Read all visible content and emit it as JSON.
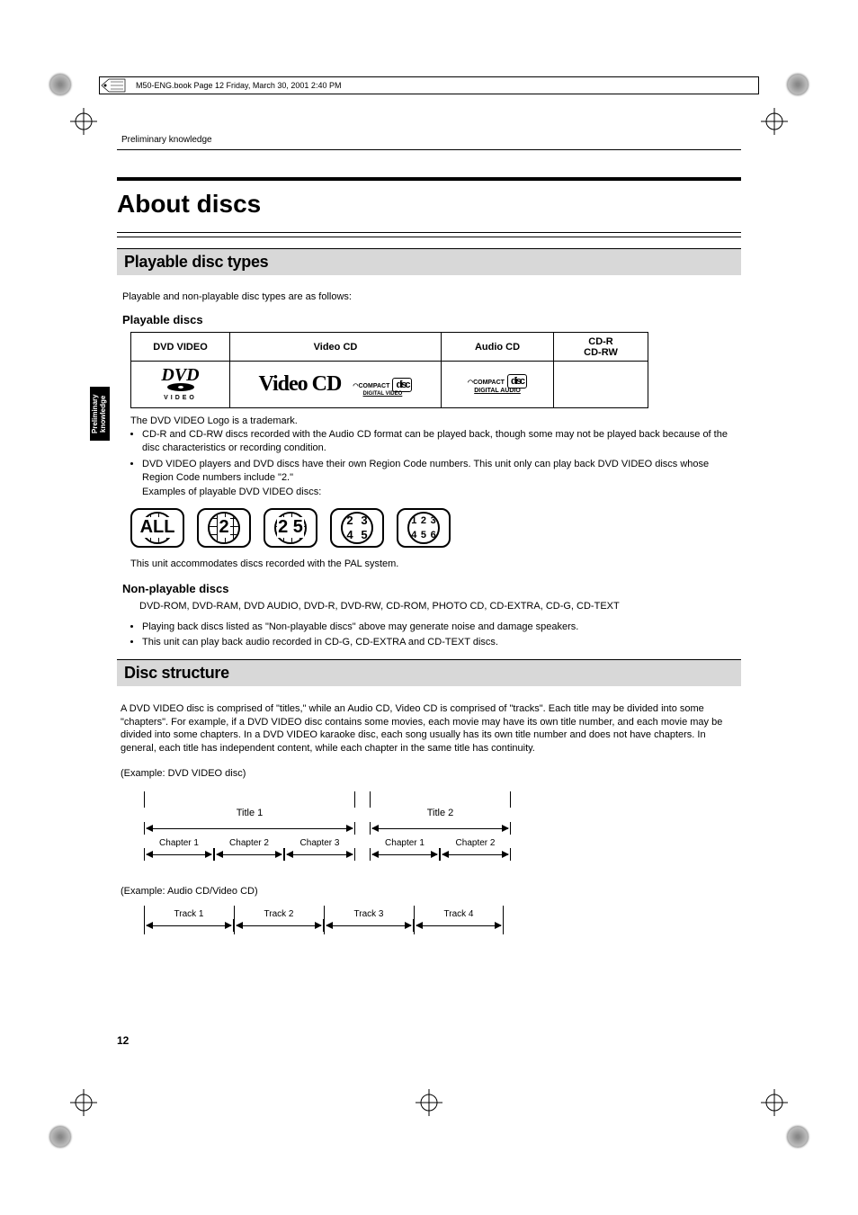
{
  "header_text": "M50-ENG.book  Page 12  Friday, March 30, 2001  2:40 PM",
  "section_label": "Preliminary knowledge",
  "side_tab": "Preliminary knowledge",
  "page_title": "About discs",
  "page_number": "12",
  "sections": {
    "playable_types": {
      "heading": "Playable disc types",
      "intro": "Playable and non-playable disc types are as follows:",
      "playable_sub": "Playable discs",
      "table_headers": [
        "DVD VIDEO",
        "Video CD",
        "Audio CD",
        "CD-R\nCD-RW"
      ],
      "logos": {
        "dvd_main": "DVD",
        "dvd_sub": "VIDEO",
        "vcd": "Video CD",
        "compact": "COMPACT",
        "disc": "disc",
        "digital_video": "DIGITAL VIDEO",
        "digital_audio": "DIGITAL AUDIO"
      },
      "trademark_note": "The DVD VIDEO Logo is a trademark.",
      "bullets_top": [
        "CD-R and CD-RW discs recorded with the Audio CD format can be played back, though some may not be played back because of the disc characteristics or recording condition.",
        "DVD VIDEO players and DVD discs have their own Region Code numbers. This unit only can play back DVD VIDEO discs whose Region Code numbers include \"2.\""
      ],
      "examples_line": "Examples of playable DVD VIDEO discs:",
      "region_codes": [
        "ALL",
        "2",
        "2 5",
        "2 3 4 5",
        "1 2 3 4 5 6"
      ],
      "pal_note": "This unit accommodates discs recorded with the PAL system.",
      "nonplayable_sub": "Non-playable discs",
      "nonplayable_list": "DVD-ROM, DVD-RAM, DVD AUDIO, DVD-R, DVD-RW, CD-ROM, PHOTO CD, CD-EXTRA, CD-G, CD-TEXT",
      "bullets_bottom": [
        "Playing back discs listed as \"Non-playable discs\" above may generate noise and damage speakers.",
        "This unit can play back audio recorded in CD-G, CD-EXTRA and CD-TEXT discs."
      ]
    },
    "disc_structure": {
      "heading": "Disc structure",
      "para": "A DVD VIDEO disc is comprised of \"titles,\" while an Audio CD, Video CD is comprised of \"tracks\". Each title may be divided into some \"chapters\". For example, if a DVD VIDEO disc contains some movies, each movie may have its own title number, and each movie may be divided into some chapters. In a DVD VIDEO karaoke disc, each song usually has its own title number and does not have chapters. In general, each title has independent content, while each chapter in the same title has continuity.",
      "example1_label": "(Example: DVD VIDEO disc)",
      "example2_label": "(Example: Audio CD/Video CD)",
      "diagram1": {
        "titles": [
          "Title 1",
          "Title 2"
        ],
        "title1_chapters": [
          "Chapter 1",
          "Chapter 2",
          "Chapter 3"
        ],
        "title2_chapters": [
          "Chapter 1",
          "Chapter 2"
        ]
      },
      "diagram2": {
        "tracks": [
          "Track 1",
          "Track 2",
          "Track 3",
          "Track 4"
        ]
      }
    }
  }
}
